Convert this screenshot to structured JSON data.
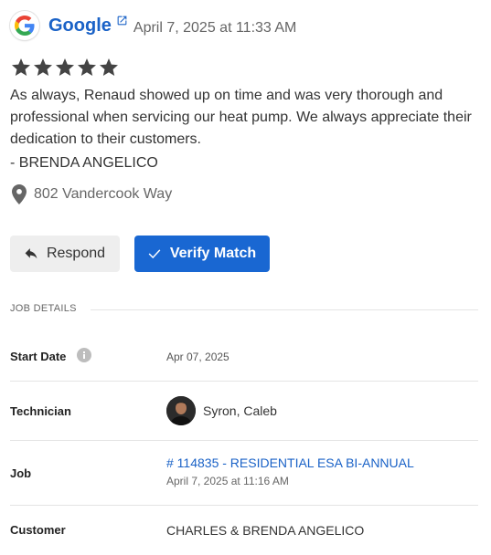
{
  "review": {
    "source_name": "Google",
    "date": "April 7, 2025 at 11:33 AM",
    "rating": 5,
    "rating_max": 5,
    "text": "As always, Renaud showed up on time and was very thorough and professional when servicing our heat pump. We always appreciate their dedication to their customers.",
    "reviewer": "- BRENDA ANGELICO",
    "address": "802 Vandercook Way"
  },
  "actions": {
    "respond_label": "Respond",
    "verify_label": "Verify Match"
  },
  "job_details": {
    "section_title": "JOB DETAILS",
    "start_date_label": "Start Date",
    "start_date_value": "Apr 07, 2025",
    "technician_label": "Technician",
    "technician_name": "Syron, Caleb",
    "job_label": "Job",
    "job_link": "# 114835 - RESIDENTIAL ESA BI-ANNUAL",
    "job_date": "April 7, 2025 at 11:16 AM",
    "customer_label": "Customer",
    "customer_value": "CHARLES & BRENDA ANGELICO"
  },
  "icons": {
    "source": "google-logo-icon",
    "external": "external-link-icon",
    "star": "star-icon",
    "location": "map-pin-icon",
    "respond": "reply-icon",
    "verify": "check-icon",
    "info": "info-icon"
  },
  "colors": {
    "link": "#1a62c7",
    "primary_button": "#1967d2",
    "star": "#444444"
  }
}
